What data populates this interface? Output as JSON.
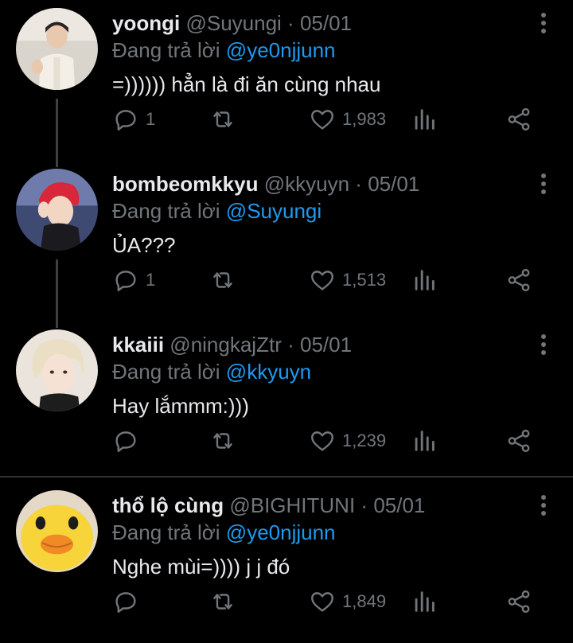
{
  "colors": {
    "background": "#000000",
    "name": "#e7e9ea",
    "muted": "#71767b",
    "mention": "#1d9bf0",
    "thread_line": "#3e4144"
  },
  "tweets": [
    {
      "name": "yoongi",
      "handle": "@Suyungi",
      "separator": "·",
      "date": "05/01",
      "reply_prefix": "Đang trả lời",
      "reply_to": "@ye0njjunn",
      "text": "=)))))) hẳn là đi ăn cùng nhau",
      "replies": "1",
      "likes": "1,983"
    },
    {
      "name": "bombeomkkyu",
      "handle": "@kkyuyn",
      "separator": "·",
      "date": "05/01",
      "reply_prefix": "Đang trả lời",
      "reply_to": "@Suyungi",
      "text": "ỦA???",
      "replies": "1",
      "likes": "1,513"
    },
    {
      "name": "kkaiii",
      "handle": "@ningkajZtr",
      "separator": "·",
      "date": "05/01",
      "reply_prefix": "Đang trả lời",
      "reply_to": "@kkyuyn",
      "text": "Hay lắmmm:)))",
      "replies": "",
      "likes": "1,239"
    },
    {
      "name": "thổ lộ cùng",
      "handle": "@BIGHITUNI",
      "separator": "·",
      "date": "05/01",
      "reply_prefix": "Đang trả lời",
      "reply_to": "@ye0njjunn",
      "text": "Nghe mùi=)))) j j đó",
      "replies": "",
      "likes": "1,849"
    }
  ],
  "icons": [
    "reply-icon",
    "retweet-icon",
    "like-icon",
    "analytics-icon",
    "share-icon",
    "more-options-icon"
  ]
}
